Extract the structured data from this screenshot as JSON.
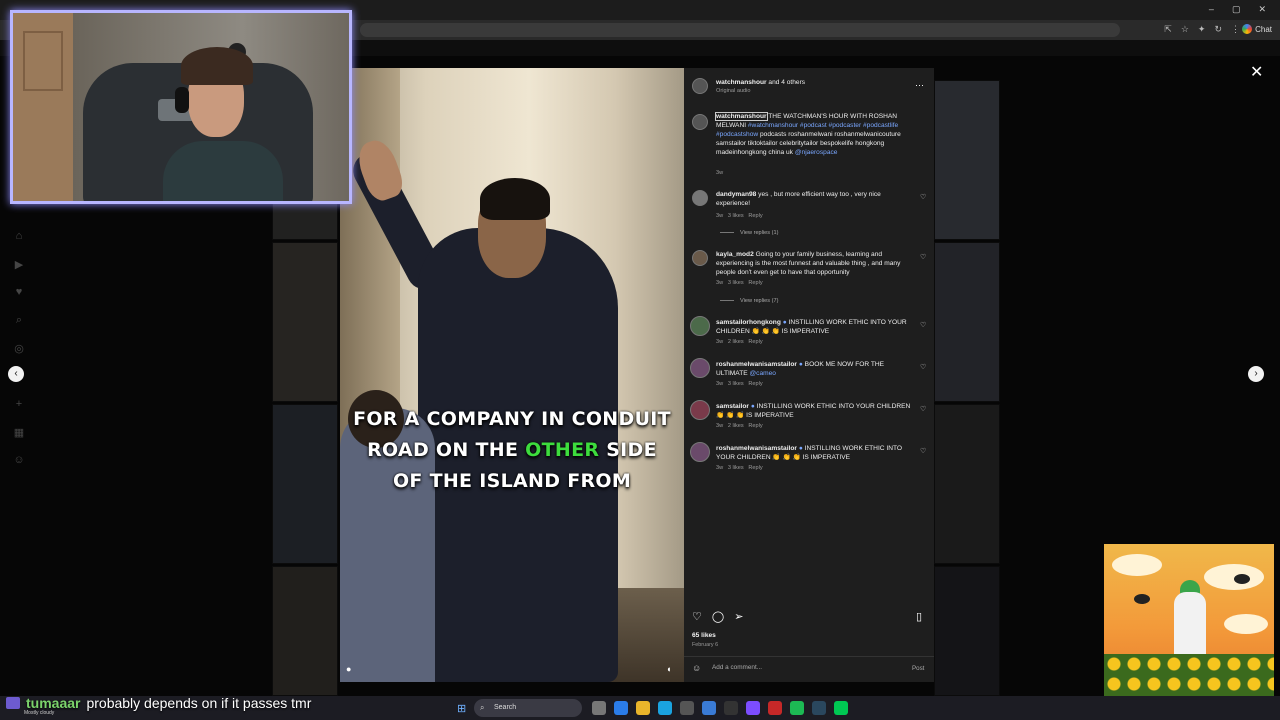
{
  "browser": {
    "window_controls": [
      "–",
      "▢",
      "✕"
    ],
    "chat_label": "Chat"
  },
  "post": {
    "header": {
      "author": "watchmanshour",
      "others": "and 4 others",
      "audio": "Original audio"
    },
    "caption": {
      "user": "watchmanshour",
      "text": "THE WATCHMAN'S HOUR WITH ROSHAN MELWANI",
      "hashtags": "#watchmanshour #podcast #podcaster #podcastlife #podcastshow",
      "body": "podcasts roshanmelwani roshanmelwanicouture samstailor tiktoktailor celebritytailor bespokelife hongkong madeinhongkong china uk",
      "mention": "@njaerospace",
      "time": "3w"
    },
    "comments": [
      {
        "user": "dandyman98",
        "text": "yes , but more efficient way too , very nice experience!",
        "time": "3w",
        "likes": "3 likes",
        "reply": "Reply",
        "view_replies": "View replies (1)"
      },
      {
        "user": "kayla_mod2",
        "text": "Going to your family business, learning and experiencing is the most funnest and valuable thing , and many people don't even get to have that opportunity",
        "time": "3w",
        "likes": "3 likes",
        "reply": "Reply",
        "view_replies": "View replies (7)"
      },
      {
        "user": "samstailorhongkong",
        "text": "INSTILLING WORK ETHIC INTO YOUR CHILDREN 👏 👏 👏 IS IMPERATIVE",
        "time": "3w",
        "likes": "2 likes",
        "reply": "Reply"
      },
      {
        "user": "roshanmelwanisamstailor",
        "text": "BOOK ME NOW FOR THE ULTIMATE",
        "mention": "@cameo",
        "time": "3w",
        "likes": "3 likes",
        "reply": "Reply"
      },
      {
        "user": "samstailor",
        "text": "INSTILLING WORK ETHIC INTO YOUR CHILDREN 👏 👏 👏 IS IMPERATIVE",
        "time": "3w",
        "likes": "2 likes",
        "reply": "Reply"
      },
      {
        "user": "roshanmelwanisamstailor",
        "text": "INSTILLING WORK ETHIC INTO YOUR CHILDREN 👏 👏 👏 IS IMPERATIVE",
        "time": "3w",
        "likes": "3 likes",
        "reply": "Reply"
      }
    ],
    "likes": "65 likes",
    "date": "February 6",
    "add_comment_placeholder": "Add a comment...",
    "post_button": "Post"
  },
  "video": {
    "caption_line1": "FOR A COMPANY IN CONDUIT",
    "caption_line2_a": "ROAD ON THE",
    "caption_line2_hl": "OTHER",
    "caption_line2_b": "SIDE",
    "caption_line3": "OF THE ISLAND FROM"
  },
  "overlay_chat": {
    "user": "tumaaar",
    "message": "probably depends on if it passes tmr",
    "weather": "Mostly cloudy"
  },
  "taskbar": {
    "search_label": "Search"
  },
  "icons": {
    "close": "close-icon",
    "prev": "chevron-left-icon",
    "next": "chevron-right-icon",
    "like": "heart-icon",
    "comment": "comment-icon",
    "share": "share-icon",
    "save": "bookmark-icon",
    "more": "more-icon"
  },
  "colors": {
    "accent_link": "#7aa7ff",
    "webcam_border": "#b8b6ff",
    "chat_user": "#7bd36b",
    "caption_highlight": "#3ddc3d"
  }
}
